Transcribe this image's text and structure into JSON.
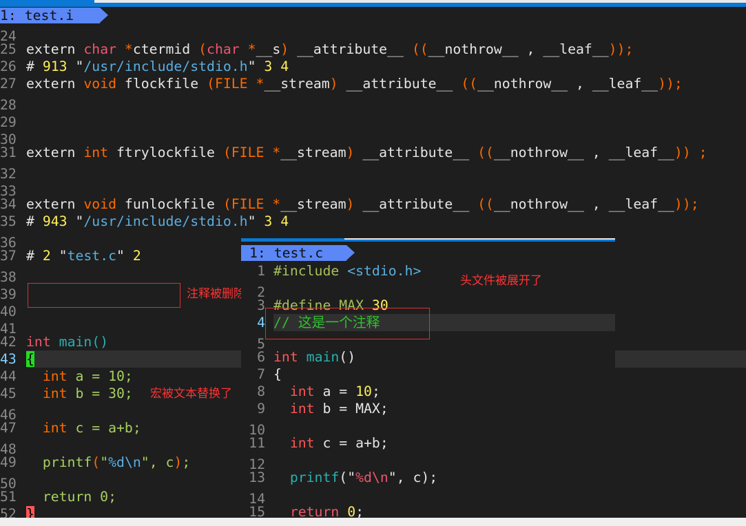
{
  "colors": {
    "w": "#e6e6e6",
    "kw": "#f0566c",
    "or": "#ff6a00",
    "num": "#ffef5a",
    "str": "#5aaee0",
    "fn": "#2ab0b0",
    "gr": "#a8d060",
    "ol": "#a6c05a",
    "red": "#ff5555",
    "cm": "#30c030",
    "dim": "#8a8a8a"
  },
  "left": {
    "tab": "1: test.i",
    "current_line": 43,
    "lines": [
      {
        "n": "24",
        "s": []
      },
      {
        "n": "25",
        "s": [
          [
            "extern ",
            "w"
          ],
          [
            "char",
            "kw"
          ],
          [
            " *",
            "or"
          ],
          [
            "ctermid ",
            "w"
          ],
          [
            "(",
            "or"
          ],
          [
            "char",
            "kw"
          ],
          [
            " *",
            "or"
          ],
          [
            "__s",
            "w"
          ],
          [
            ")",
            "or"
          ],
          [
            " __attribute__ ",
            "w"
          ],
          [
            "((",
            "or"
          ],
          [
            "__nothrow__ , __leaf__",
            "w"
          ],
          [
            "));",
            "or"
          ]
        ]
      },
      {
        "n": "26",
        "s": [
          [
            "# ",
            "w"
          ],
          [
            "913",
            "num"
          ],
          [
            " \"",
            "w"
          ],
          [
            "/usr/include/stdio.h",
            "str"
          ],
          [
            "\" ",
            "w"
          ],
          [
            "3 4",
            "num"
          ]
        ]
      },
      {
        "n": "27",
        "s": [
          [
            "extern ",
            "w"
          ],
          [
            "void",
            "or"
          ],
          [
            " flockfile ",
            "w"
          ],
          [
            "(FILE *",
            "or"
          ],
          [
            "__stream",
            "w"
          ],
          [
            ")",
            "or"
          ],
          [
            " __attribute__ ",
            "w"
          ],
          [
            "((",
            "or"
          ],
          [
            "__nothrow__ , __leaf__",
            "w"
          ],
          [
            "));",
            "or"
          ]
        ]
      },
      {
        "n": "28",
        "s": []
      },
      {
        "n": "29",
        "s": []
      },
      {
        "n": "30",
        "s": []
      },
      {
        "n": "31",
        "s": [
          [
            "extern ",
            "w"
          ],
          [
            "int",
            "or"
          ],
          [
            " ftrylockfile ",
            "w"
          ],
          [
            "(FILE *",
            "or"
          ],
          [
            "__stream",
            "w"
          ],
          [
            ")",
            "or"
          ],
          [
            " __attribute__ ",
            "w"
          ],
          [
            "((",
            "or"
          ],
          [
            "__nothrow__ , __leaf__",
            "w"
          ],
          [
            ")) ;",
            "or"
          ]
        ]
      },
      {
        "n": "32",
        "s": []
      },
      {
        "n": "33",
        "s": []
      },
      {
        "n": "34",
        "s": [
          [
            "extern ",
            "w"
          ],
          [
            "void",
            "or"
          ],
          [
            " funlockfile ",
            "w"
          ],
          [
            "(FILE *",
            "or"
          ],
          [
            "__stream",
            "w"
          ],
          [
            ")",
            "or"
          ],
          [
            " __attribute__ ",
            "w"
          ],
          [
            "((",
            "or"
          ],
          [
            "__nothrow__ , __leaf__",
            "w"
          ],
          [
            "));",
            "or"
          ]
        ]
      },
      {
        "n": "35",
        "s": [
          [
            "# ",
            "w"
          ],
          [
            "943",
            "num"
          ],
          [
            " \"",
            "w"
          ],
          [
            "/usr/include/stdio.h",
            "str"
          ],
          [
            "\" ",
            "w"
          ],
          [
            "3 4",
            "num"
          ]
        ]
      },
      {
        "n": "36",
        "s": []
      },
      {
        "n": "37",
        "s": [
          [
            "# ",
            "w"
          ],
          [
            "2",
            "num"
          ],
          [
            " \"",
            "w"
          ],
          [
            "test.c",
            "str"
          ],
          [
            "\" ",
            "w"
          ],
          [
            "2",
            "num"
          ]
        ]
      },
      {
        "n": "38",
        "s": []
      },
      {
        "n": "39",
        "s": []
      },
      {
        "n": "40",
        "s": []
      },
      {
        "n": "41",
        "s": []
      },
      {
        "n": "42",
        "s": [
          [
            "int",
            "kw"
          ],
          [
            " ",
            "w"
          ],
          [
            "main",
            "fn"
          ],
          [
            "()",
            "fn"
          ]
        ]
      },
      {
        "n": "43",
        "s": [
          [
            "{",
            "brace-green"
          ]
        ]
      },
      {
        "n": "44",
        "s": [
          [
            "  ",
            "w"
          ],
          [
            "int",
            "or"
          ],
          [
            " a = ",
            "gr"
          ],
          [
            "10;",
            "gr"
          ]
        ]
      },
      {
        "n": "45",
        "s": [
          [
            "  ",
            "w"
          ],
          [
            "int",
            "or"
          ],
          [
            " b = ",
            "gr"
          ],
          [
            "30;",
            "gr"
          ]
        ]
      },
      {
        "n": "46",
        "s": []
      },
      {
        "n": "47",
        "s": [
          [
            "  ",
            "w"
          ],
          [
            "int",
            "or"
          ],
          [
            " c = a+b;",
            "gr"
          ]
        ]
      },
      {
        "n": "48",
        "s": []
      },
      {
        "n": "49",
        "s": [
          [
            "  printf",
            "gr"
          ],
          [
            "(",
            "or"
          ],
          [
            "\"",
            "gr"
          ],
          [
            "%d\\n",
            "str"
          ],
          [
            "\"",
            "gr"
          ],
          [
            ", c",
            "gr"
          ],
          [
            ")",
            "or"
          ],
          [
            ";",
            "gr"
          ]
        ]
      },
      {
        "n": "50",
        "s": []
      },
      {
        "n": "51",
        "s": [
          [
            "  return 0;",
            "gr"
          ]
        ]
      },
      {
        "n": "52",
        "s": [
          [
            "}",
            "brace-red"
          ]
        ]
      }
    ]
  },
  "right": {
    "tab": "1: test.c",
    "current_line": 4,
    "lines": [
      {
        "n": "1",
        "s": [
          [
            "#include ",
            "ol"
          ],
          [
            "<stdio.h>",
            "str"
          ]
        ]
      },
      {
        "n": "2",
        "s": []
      },
      {
        "n": "3",
        "s": [
          [
            "#define MAX ",
            "ol"
          ],
          [
            "30",
            "num"
          ]
        ]
      },
      {
        "n": "4",
        "s": [
          [
            "// 这是一个注释",
            "cm"
          ]
        ]
      },
      {
        "n": "5",
        "s": []
      },
      {
        "n": "6",
        "s": [
          [
            "int",
            "red"
          ],
          [
            " ",
            "w"
          ],
          [
            "main",
            "fn"
          ],
          [
            "()",
            "w"
          ]
        ]
      },
      {
        "n": "7",
        "s": [
          [
            "{",
            "w"
          ]
        ]
      },
      {
        "n": "8",
        "s": [
          [
            "  ",
            "w"
          ],
          [
            "int",
            "red"
          ],
          [
            " a = ",
            "w"
          ],
          [
            "10",
            "num"
          ],
          [
            ";",
            "w"
          ]
        ]
      },
      {
        "n": "9",
        "s": [
          [
            "  ",
            "w"
          ],
          [
            "int",
            "red"
          ],
          [
            " b = MAX;",
            "w"
          ]
        ]
      },
      {
        "n": "10",
        "s": []
      },
      {
        "n": "11",
        "s": [
          [
            "  ",
            "w"
          ],
          [
            "int",
            "red"
          ],
          [
            " c = a+b;",
            "w"
          ]
        ]
      },
      {
        "n": "12",
        "s": []
      },
      {
        "n": "13",
        "s": [
          [
            "  printf",
            "fn"
          ],
          [
            "(\"",
            "w"
          ],
          [
            "%d\\n",
            "kw"
          ],
          [
            "\", c);",
            "w"
          ]
        ]
      },
      {
        "n": "14",
        "s": []
      },
      {
        "n": "15",
        "s": [
          [
            "  ",
            "w"
          ],
          [
            "return",
            "kw"
          ],
          [
            " ",
            "w"
          ],
          [
            "0",
            "num"
          ],
          [
            ";",
            "w"
          ]
        ]
      }
    ]
  },
  "annotations": {
    "comment_removed": "注释被删除了",
    "macro_replaced": "宏被文本替换了",
    "header_expanded": "头文件被展开了"
  }
}
